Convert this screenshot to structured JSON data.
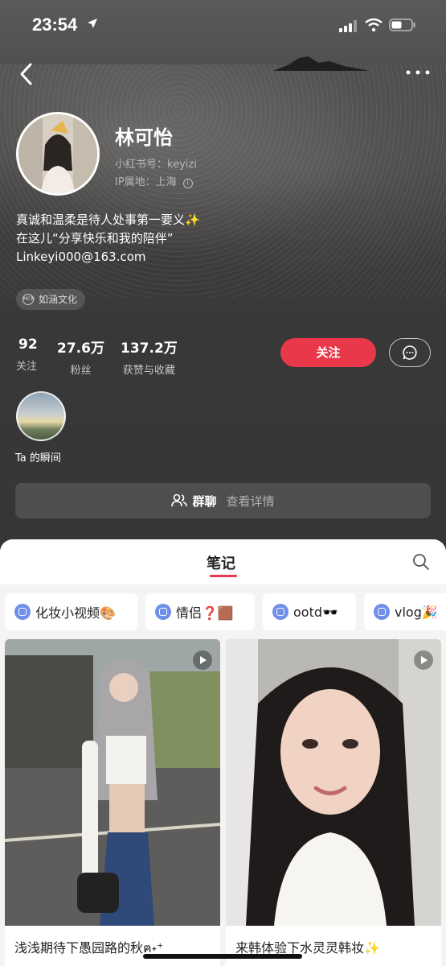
{
  "status_bar": {
    "time": "23:54"
  },
  "profile": {
    "name": "林可怡",
    "red_id": "小红书号：keyizi",
    "ip_location": "IP属地：上海",
    "bio_lines": [
      "真诚和温柔是待人处事第一要义✨",
      "在这儿“分享快乐和我的陪伴”",
      "Linkeyi000@163.com"
    ],
    "tag": "如涵文化"
  },
  "stats": [
    {
      "value": "92",
      "label": "关注"
    },
    {
      "value": "27.6万",
      "label": "粉丝"
    },
    {
      "value": "137.2万",
      "label": "获赞与收藏"
    }
  ],
  "actions": {
    "follow": "关注"
  },
  "moment": {
    "label": "Ta 的瞬间"
  },
  "group": {
    "label": "群聊",
    "detail": "查看详情"
  },
  "tabs": {
    "notes": "笔记"
  },
  "collections": [
    "化妆小视频🎨",
    "情侣❓🟫",
    "ootd🕶️",
    "vlog🎉"
  ],
  "posts": [
    {
      "title": "浅浅期待下愚园路的秋ฅ˖⁺"
    },
    {
      "title": "来韩体验下水灵灵韩妆✨"
    }
  ],
  "colors": {
    "accent": "#e8384a",
    "dark_bg": "#363636"
  }
}
